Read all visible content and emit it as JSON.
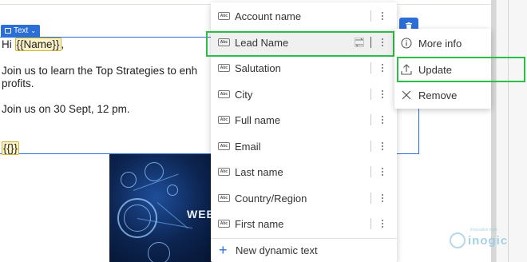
{
  "editor": {
    "block_tag": "Text",
    "greeting_prefix": "Hi ",
    "name_token": "{{Name}}",
    "greeting_suffix": ",",
    "body_line1": "Join us to learn the Top Strategies to enh",
    "body_line2": "profits.",
    "event_line": "Join us on 30 Sept, 12 pm.",
    "empty_token": "{{}}",
    "hero_caption": "WEB"
  },
  "dynamic_text_menu": {
    "items": [
      {
        "label": "Account name"
      },
      {
        "label": "Lead Name"
      },
      {
        "label": "Salutation"
      },
      {
        "label": "City"
      },
      {
        "label": "Full name"
      },
      {
        "label": "Email"
      },
      {
        "label": "Last name"
      },
      {
        "label": "Country/Region"
      },
      {
        "label": "First name"
      }
    ],
    "selected_label": "Lead Name",
    "field_icon_text": "Abc",
    "footer_label": "New dynamic text"
  },
  "context_menu": {
    "items": [
      {
        "label": "More info",
        "icon": "info-icon"
      },
      {
        "label": "Update",
        "icon": "upload-icon"
      },
      {
        "label": "Remove",
        "icon": "close-icon"
      }
    ],
    "highlighted_label": "Update"
  },
  "watermark": {
    "text": "inogic",
    "subtext": "innovative logic"
  },
  "colors": {
    "accent_blue": "#2b6fd6",
    "highlight_green": "#2bbf4a",
    "token_fill": "#fbf2c8",
    "token_border": "#d4b339"
  }
}
